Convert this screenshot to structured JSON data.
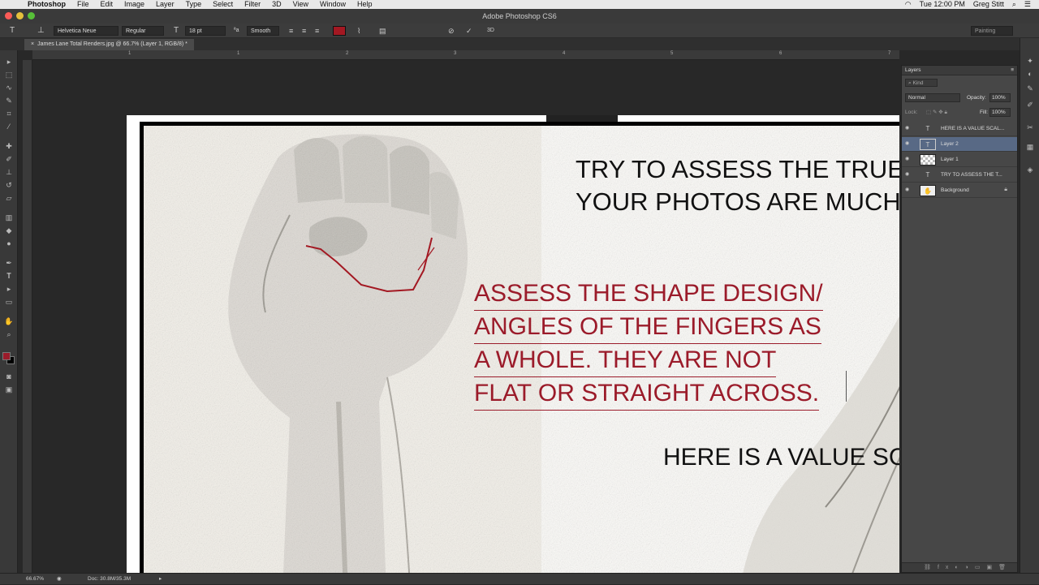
{
  "menubar": {
    "apple": "",
    "items": [
      "Photoshop",
      "File",
      "Edit",
      "Image",
      "Layer",
      "Type",
      "Select",
      "Filter",
      "3D",
      "View",
      "Window",
      "Help"
    ],
    "clock": "Tue 12:00 PM",
    "user": "Greg Stitt"
  },
  "window": {
    "title": "Adobe Photoshop CS6"
  },
  "options": {
    "font_family": "Helvetica Neue",
    "font_style": "Regular",
    "font_size": "18 pt",
    "antialias": "Smooth",
    "text_color": "#a31822",
    "workspace": "Painting"
  },
  "document": {
    "tab_title": "James Lane Total Renders.jpg @ 66.7% (Layer 1, RGB/8) *"
  },
  "ruler": {
    "h_ticks": [
      "1",
      "2",
      "3",
      "4",
      "5",
      "6",
      "7"
    ]
  },
  "canvas_text": {
    "try_line1": "TRY TO ASSESS THE TRUE",
    "try_line2": "YOUR PHOTOS ARE MUCH",
    "assess_lines": [
      "ASSESS THE SHAPE DESIGN/",
      "ANGLES OF THE FINGERS AS",
      "A WHOLE.  THEY ARE NOT",
      "FLAT OR STRAIGHT ACROSS."
    ],
    "value_line": "HERE IS A VALUE SC"
  },
  "layers_panel": {
    "title": "Layers",
    "filter": "Kind",
    "blend_mode": "Normal",
    "opacity_label": "Opacity:",
    "opacity": "100%",
    "lock_label": "Lock:",
    "fill_label": "Fill:",
    "fill": "100%",
    "layers": [
      {
        "name": "HERE IS A VALUE SCAL...",
        "type": "text"
      },
      {
        "name": "Layer 2",
        "type": "raster",
        "selected": true
      },
      {
        "name": "Layer 1",
        "type": "raster"
      },
      {
        "name": "TRY TO ASSESS THE T...",
        "type": "text"
      },
      {
        "name": "Background",
        "type": "background"
      }
    ]
  },
  "status": {
    "zoom": "66.67%",
    "doc": "Doc: 30.8M/35.3M"
  }
}
